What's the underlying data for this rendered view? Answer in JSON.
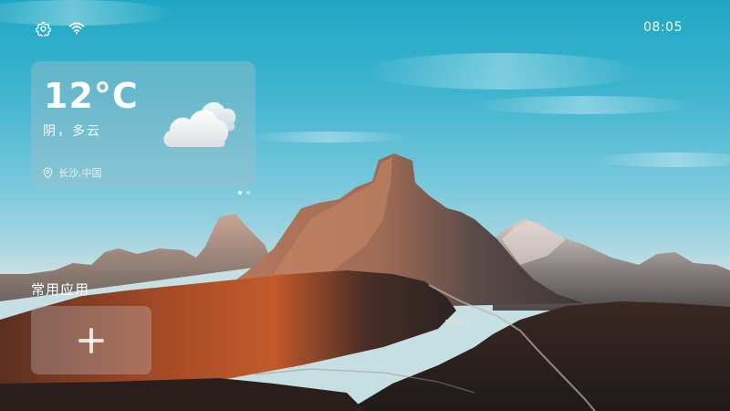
{
  "status_bar": {
    "time": "08:05",
    "settings_icon": "gear-icon",
    "wifi_icon": "wifi-icon"
  },
  "weather": {
    "temperature": "12°C",
    "condition": "阴，多云",
    "location": "长沙,中国",
    "location_icon": "location-pin-icon",
    "weather_icon": "cloud-icon"
  },
  "pager": {
    "total": 2,
    "active_index": 0
  },
  "apps": {
    "title": "常用应用",
    "add_icon": "plus-icon"
  },
  "colors": {
    "sky_top": "#1ea7c4",
    "card_bg": "rgba(160,190,200,0.42)"
  }
}
